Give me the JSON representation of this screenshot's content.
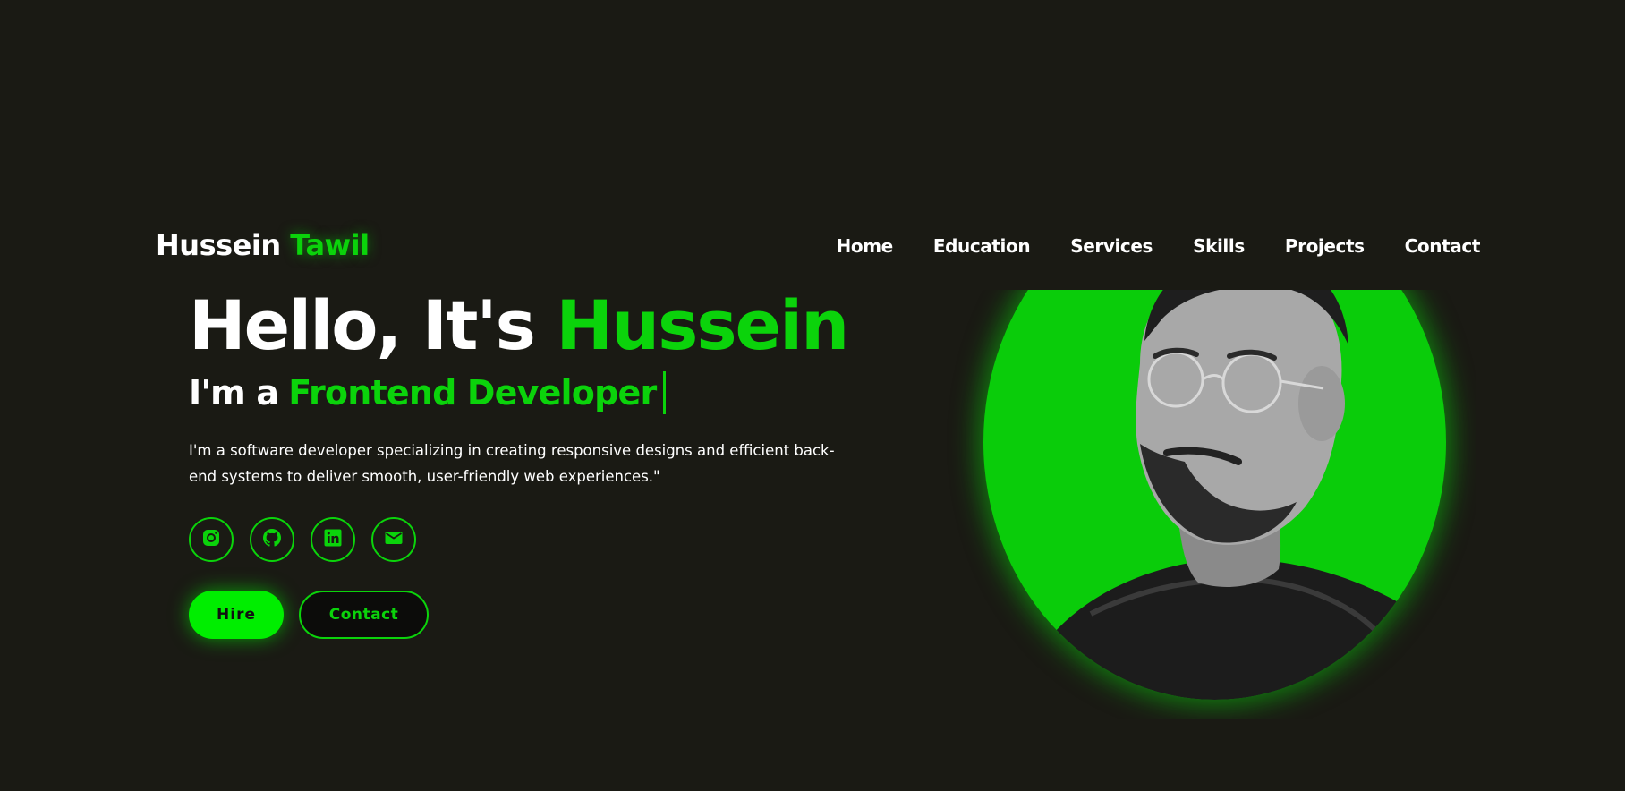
{
  "brand": {
    "first": "Hussein",
    "accent": "Tawil"
  },
  "nav": [
    "Home",
    "Education",
    "Services",
    "Skills",
    "Projects",
    "Contact"
  ],
  "hero": {
    "greeting": "Hello, It's",
    "name": "Hussein",
    "role_prefix": "I'm a",
    "role": "Frontend Developer",
    "description": "I'm a software developer specializing in creating responsive designs and efficient back-end systems to deliver smooth, user-friendly web experiences.\""
  },
  "socials": [
    {
      "icon": "instagram-icon"
    },
    {
      "icon": "github-icon"
    },
    {
      "icon": "linkedin-icon"
    },
    {
      "icon": "email-icon"
    }
  ],
  "buttons": {
    "hire": "Hire",
    "contact": "Contact"
  },
  "colors": {
    "accent": "#0bd30b",
    "bright": "#00ee00",
    "background": "#1a1a14"
  }
}
